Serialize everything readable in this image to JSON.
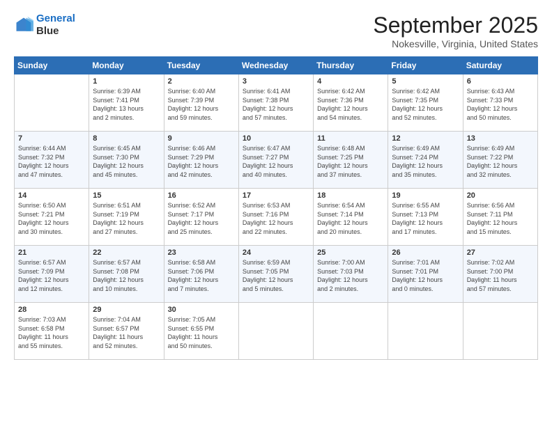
{
  "logo": {
    "line1": "General",
    "line2": "Blue"
  },
  "title": "September 2025",
  "location": "Nokesville, Virginia, United States",
  "days_header": [
    "Sunday",
    "Monday",
    "Tuesday",
    "Wednesday",
    "Thursday",
    "Friday",
    "Saturday"
  ],
  "weeks": [
    [
      {
        "day": "",
        "info": ""
      },
      {
        "day": "1",
        "info": "Sunrise: 6:39 AM\nSunset: 7:41 PM\nDaylight: 13 hours\nand 2 minutes."
      },
      {
        "day": "2",
        "info": "Sunrise: 6:40 AM\nSunset: 7:39 PM\nDaylight: 12 hours\nand 59 minutes."
      },
      {
        "day": "3",
        "info": "Sunrise: 6:41 AM\nSunset: 7:38 PM\nDaylight: 12 hours\nand 57 minutes."
      },
      {
        "day": "4",
        "info": "Sunrise: 6:42 AM\nSunset: 7:36 PM\nDaylight: 12 hours\nand 54 minutes."
      },
      {
        "day": "5",
        "info": "Sunrise: 6:42 AM\nSunset: 7:35 PM\nDaylight: 12 hours\nand 52 minutes."
      },
      {
        "day": "6",
        "info": "Sunrise: 6:43 AM\nSunset: 7:33 PM\nDaylight: 12 hours\nand 50 minutes."
      }
    ],
    [
      {
        "day": "7",
        "info": "Sunrise: 6:44 AM\nSunset: 7:32 PM\nDaylight: 12 hours\nand 47 minutes."
      },
      {
        "day": "8",
        "info": "Sunrise: 6:45 AM\nSunset: 7:30 PM\nDaylight: 12 hours\nand 45 minutes."
      },
      {
        "day": "9",
        "info": "Sunrise: 6:46 AM\nSunset: 7:29 PM\nDaylight: 12 hours\nand 42 minutes."
      },
      {
        "day": "10",
        "info": "Sunrise: 6:47 AM\nSunset: 7:27 PM\nDaylight: 12 hours\nand 40 minutes."
      },
      {
        "day": "11",
        "info": "Sunrise: 6:48 AM\nSunset: 7:25 PM\nDaylight: 12 hours\nand 37 minutes."
      },
      {
        "day": "12",
        "info": "Sunrise: 6:49 AM\nSunset: 7:24 PM\nDaylight: 12 hours\nand 35 minutes."
      },
      {
        "day": "13",
        "info": "Sunrise: 6:49 AM\nSunset: 7:22 PM\nDaylight: 12 hours\nand 32 minutes."
      }
    ],
    [
      {
        "day": "14",
        "info": "Sunrise: 6:50 AM\nSunset: 7:21 PM\nDaylight: 12 hours\nand 30 minutes."
      },
      {
        "day": "15",
        "info": "Sunrise: 6:51 AM\nSunset: 7:19 PM\nDaylight: 12 hours\nand 27 minutes."
      },
      {
        "day": "16",
        "info": "Sunrise: 6:52 AM\nSunset: 7:17 PM\nDaylight: 12 hours\nand 25 minutes."
      },
      {
        "day": "17",
        "info": "Sunrise: 6:53 AM\nSunset: 7:16 PM\nDaylight: 12 hours\nand 22 minutes."
      },
      {
        "day": "18",
        "info": "Sunrise: 6:54 AM\nSunset: 7:14 PM\nDaylight: 12 hours\nand 20 minutes."
      },
      {
        "day": "19",
        "info": "Sunrise: 6:55 AM\nSunset: 7:13 PM\nDaylight: 12 hours\nand 17 minutes."
      },
      {
        "day": "20",
        "info": "Sunrise: 6:56 AM\nSunset: 7:11 PM\nDaylight: 12 hours\nand 15 minutes."
      }
    ],
    [
      {
        "day": "21",
        "info": "Sunrise: 6:57 AM\nSunset: 7:09 PM\nDaylight: 12 hours\nand 12 minutes."
      },
      {
        "day": "22",
        "info": "Sunrise: 6:57 AM\nSunset: 7:08 PM\nDaylight: 12 hours\nand 10 minutes."
      },
      {
        "day": "23",
        "info": "Sunrise: 6:58 AM\nSunset: 7:06 PM\nDaylight: 12 hours\nand 7 minutes."
      },
      {
        "day": "24",
        "info": "Sunrise: 6:59 AM\nSunset: 7:05 PM\nDaylight: 12 hours\nand 5 minutes."
      },
      {
        "day": "25",
        "info": "Sunrise: 7:00 AM\nSunset: 7:03 PM\nDaylight: 12 hours\nand 2 minutes."
      },
      {
        "day": "26",
        "info": "Sunrise: 7:01 AM\nSunset: 7:01 PM\nDaylight: 12 hours\nand 0 minutes."
      },
      {
        "day": "27",
        "info": "Sunrise: 7:02 AM\nSunset: 7:00 PM\nDaylight: 11 hours\nand 57 minutes."
      }
    ],
    [
      {
        "day": "28",
        "info": "Sunrise: 7:03 AM\nSunset: 6:58 PM\nDaylight: 11 hours\nand 55 minutes."
      },
      {
        "day": "29",
        "info": "Sunrise: 7:04 AM\nSunset: 6:57 PM\nDaylight: 11 hours\nand 52 minutes."
      },
      {
        "day": "30",
        "info": "Sunrise: 7:05 AM\nSunset: 6:55 PM\nDaylight: 11 hours\nand 50 minutes."
      },
      {
        "day": "",
        "info": ""
      },
      {
        "day": "",
        "info": ""
      },
      {
        "day": "",
        "info": ""
      },
      {
        "day": "",
        "info": ""
      }
    ]
  ]
}
